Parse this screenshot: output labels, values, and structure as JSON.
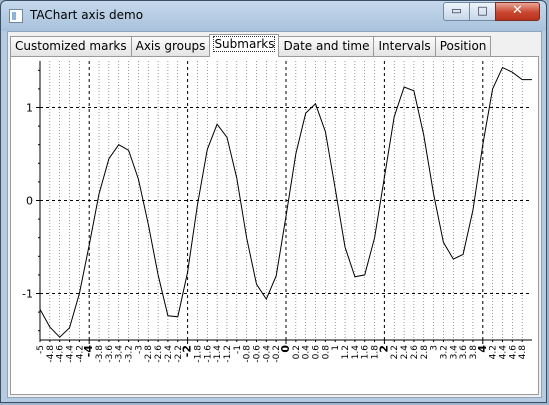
{
  "window": {
    "title": "TAChart axis demo",
    "minimize": "▭",
    "maximize": "□",
    "close": "✕"
  },
  "tabs": [
    {
      "label": "Customized marks",
      "active": false
    },
    {
      "label": "Axis groups",
      "active": false
    },
    {
      "label": "Submarks",
      "active": true
    },
    {
      "label": "Date and time",
      "active": false
    },
    {
      "label": "Intervals",
      "active": false
    },
    {
      "label": "Position",
      "active": false
    }
  ],
  "chart_data": {
    "type": "line",
    "xlim": [
      -5,
      5
    ],
    "ylim": [
      -1.5,
      1.5
    ],
    "x_major_ticks": [
      -4,
      -2,
      0,
      2,
      4
    ],
    "x_minor_step": 0.2,
    "x_tick_labels": [
      "-5",
      "-4.8",
      "-4.6",
      "-4.4",
      "-4.2",
      "-4",
      "-3.8",
      "-3.6",
      "-3.4",
      "-3.2",
      "-3",
      "-2.8",
      "-2.6",
      "-2.4",
      "-2.2",
      "-2",
      "-1.8",
      "-1.6",
      "-1.4",
      "-1.2",
      "-1",
      "-0.8",
      "-0.6",
      "-0.4",
      "-0.2",
      "0",
      "0.2",
      "0.4",
      "0.6",
      "0.8",
      "1",
      "1.2",
      "1.4",
      "1.6",
      "1.8",
      "2",
      "2.2",
      "2.4",
      "2.6",
      "2.8",
      "3",
      "3.2",
      "3.4",
      "3.6",
      "3.8",
      "4",
      "4.2",
      "4.4",
      "4.6",
      "4.8"
    ],
    "y_ticks": [
      -1,
      0,
      1
    ],
    "y_tick_labels": [
      "-1",
      "0",
      "1"
    ],
    "grid": true,
    "series": [
      {
        "x": [
          -5.0,
          -4.8,
          -4.6,
          -4.4,
          -4.2,
          -4.0,
          -3.8,
          -3.6,
          -3.4,
          -3.2,
          -3.0,
          -2.8,
          -2.6,
          -2.4,
          -2.2,
          -2.0,
          -1.8,
          -1.6,
          -1.4,
          -1.2,
          -1.0,
          -0.8,
          -0.6,
          -0.4,
          -0.2,
          0.0,
          0.2,
          0.4,
          0.6,
          0.8,
          1.0,
          1.2,
          1.4,
          1.6,
          1.8,
          2.0,
          2.2,
          2.4,
          2.6,
          2.8,
          3.0,
          3.2,
          3.4,
          3.6,
          3.8,
          4.0,
          4.2,
          4.4,
          4.6,
          4.8,
          5.0
        ],
        "y": [
          -1.17,
          -1.36,
          -1.47,
          -1.37,
          -1.0,
          -0.48,
          0.07,
          0.45,
          0.6,
          0.54,
          0.23,
          -0.25,
          -0.8,
          -1.24,
          -1.25,
          -0.77,
          -0.05,
          0.55,
          0.82,
          0.68,
          0.24,
          -0.4,
          -0.9,
          -1.06,
          -0.81,
          -0.17,
          0.5,
          0.94,
          1.04,
          0.74,
          0.13,
          -0.5,
          -0.82,
          -0.8,
          -0.4,
          0.25,
          0.9,
          1.22,
          1.18,
          0.7,
          0.07,
          -0.45,
          -0.63,
          -0.58,
          -0.1,
          0.6,
          1.2,
          1.43,
          1.38,
          1.3,
          1.3
        ]
      }
    ]
  }
}
